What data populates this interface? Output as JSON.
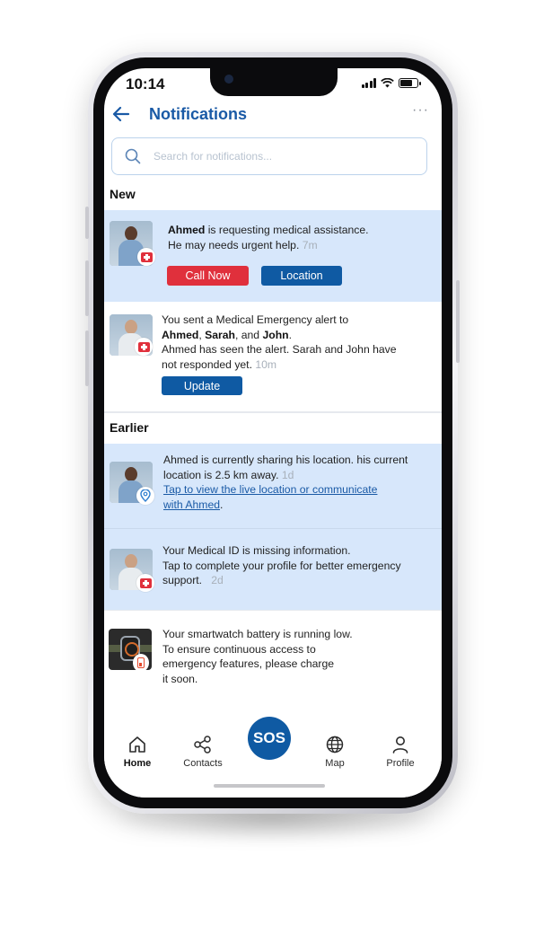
{
  "status_bar": {
    "time": "10:14"
  },
  "header": {
    "title": "Notifications",
    "more": "···"
  },
  "search": {
    "placeholder": "Search for notifications..."
  },
  "sections": {
    "new": "New",
    "earlier": "Earlier"
  },
  "notifications": [
    {
      "name_bold": "Ahmed",
      "text_1": " is requesting medical assistance.",
      "text_2": "He may needs urgent help.",
      "time": "7m",
      "buttons": {
        "call": "Call Now",
        "location": "Location"
      }
    },
    {
      "line_1": "You sent a Medical Emergency alert to",
      "name_1": "Ahmed",
      "sep_1": ", ",
      "name_2": "Sarah",
      "sep_2": ", and ",
      "name_3": "John",
      "sep_3": ".",
      "line_3": "Ahmed has seen the alert. Sarah and John have",
      "line_4": "not responded yet.",
      "time": "10m",
      "button": "Update"
    },
    {
      "line_1": "Ahmed is currently sharing his location. his current",
      "line_2": "location is 2.5 km away.",
      "time": "1d",
      "link_1": "Tap to view the live location or communicate",
      "link_2": " with Ahmed",
      "after_link": "."
    },
    {
      "line_1": "Your Medical ID is missing information.",
      "line_2": "Tap to complete your profile for better emergency",
      "line_3": "support.",
      "time": "2d"
    },
    {
      "line_1": "Your smartwatch battery is running low.",
      "line_2": "To ensure continuous access to",
      "line_3": " emergency features, please charge",
      "line_4": " it soon."
    }
  ],
  "tabbar": {
    "home": "Home",
    "contacts": "Contacts",
    "sos": "SOS",
    "map": "Map",
    "profile": "Profile"
  },
  "colors": {
    "accent": "#1a5aa6",
    "sos": "#0f5aa3",
    "danger": "#e0303c",
    "highlight": "#d7e7fb"
  }
}
